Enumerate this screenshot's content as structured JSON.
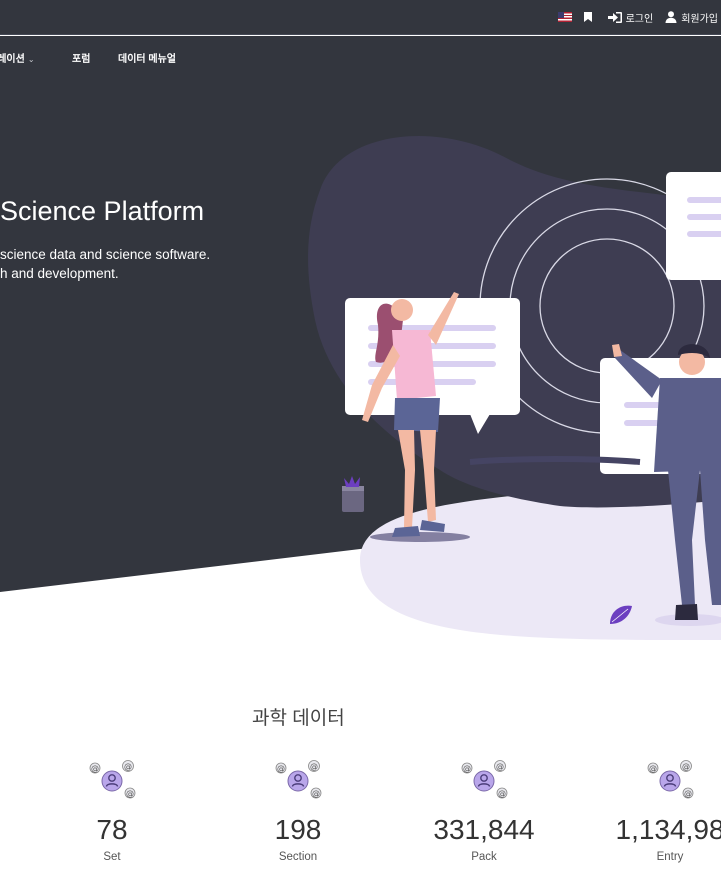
{
  "topbar": {
    "language_flag": "us-flag-icon",
    "bookmark_icon": "bookmark-icon",
    "login_label": "로그인",
    "signup_label": "회원가입"
  },
  "nav": {
    "items": [
      {
        "label": "플레이션",
        "has_dropdown": true
      },
      {
        "label": "포럼",
        "has_dropdown": false
      },
      {
        "label": "데이터 메뉴얼",
        "has_dropdown": false
      }
    ]
  },
  "hero": {
    "title": "Science Platform",
    "subtitle_line1": "science data and science software.",
    "subtitle_line2": "h and development."
  },
  "science_data": {
    "title": "과학 데이터",
    "stats": [
      {
        "value": "78",
        "label": "Set",
        "icon": "user-network-icon"
      },
      {
        "value": "198",
        "label": "Section",
        "icon": "user-network-icon"
      },
      {
        "value": "331,844",
        "label": "Pack",
        "icon": "user-network-icon"
      },
      {
        "value": "1,134,98",
        "label": "Entry",
        "icon": "user-network-icon"
      }
    ]
  },
  "colors": {
    "dark_bg": "#33363e",
    "accent_purple": "#b9a6ea",
    "light_lavender": "#ece8f6"
  }
}
